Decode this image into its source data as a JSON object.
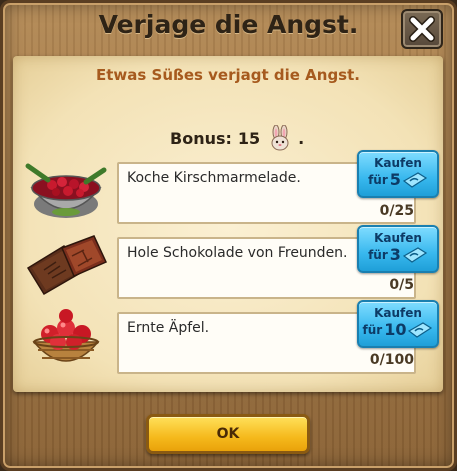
{
  "dialog": {
    "title": "Verjage die Angst.",
    "close_icon": "close-x-icon",
    "subtitle": "Etwas Süßes verjagt die Angst.",
    "bonus": {
      "label": "Bonus:",
      "value": "15",
      "icon": "bunny-icon",
      "suffix": "."
    }
  },
  "tasks": [
    {
      "description": "Koche Kirschmarmelade.",
      "progress": "0/25",
      "icon": "cherry-jam-bowl-icon",
      "buy": {
        "label": "Kaufen",
        "for": "für",
        "amount": "5",
        "currency_icon": "blue-money-icon"
      }
    },
    {
      "description": "Hole Schokolade von Freunden.",
      "progress": "0/5",
      "icon": "chocolate-bar-icon",
      "buy": {
        "label": "Kaufen",
        "for": "für",
        "amount": "3",
        "currency_icon": "blue-money-icon"
      }
    },
    {
      "description": "Ernte Äpfel.",
      "progress": "0/100",
      "icon": "apple-basket-icon",
      "buy": {
        "label": "Kaufen",
        "for": "für",
        "amount": "10",
        "currency_icon": "blue-money-icon"
      }
    }
  ],
  "ok_button": {
    "label": "OK"
  },
  "colors": {
    "subtitle": "#a65a1e",
    "buy_button": "#38b8ee",
    "ok_button": "#f5b91c",
    "wood": "#9e7443"
  }
}
